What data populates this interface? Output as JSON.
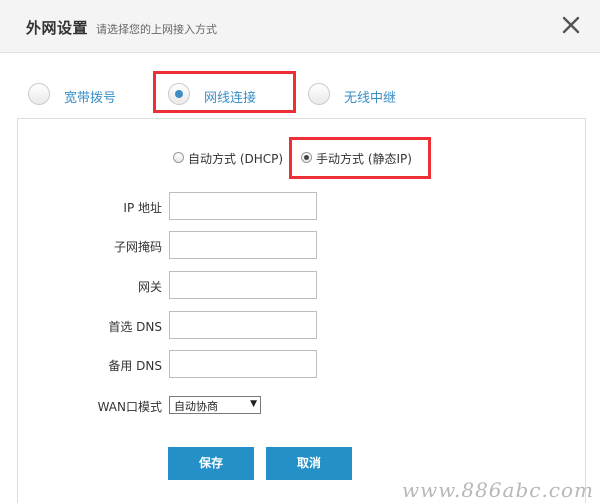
{
  "dialog": {
    "title": "外网设置",
    "subtitle": "请选择您的上网接入方式"
  },
  "tabs": [
    {
      "label": "宽带拨号",
      "selected": false
    },
    {
      "label": "网线连接",
      "selected": true
    },
    {
      "label": "无线中继",
      "selected": false
    }
  ],
  "modes": [
    {
      "label": "自动方式 (DHCP)",
      "selected": false
    },
    {
      "label": "手动方式 (静态IP)",
      "selected": true
    }
  ],
  "fields": [
    {
      "label": "IP 地址",
      "value": ""
    },
    {
      "label": "子网掩码",
      "value": ""
    },
    {
      "label": "网关",
      "value": ""
    },
    {
      "label": "首选 DNS",
      "value": ""
    },
    {
      "label": "备用 DNS",
      "value": ""
    }
  ],
  "wan_mode": {
    "label": "WAN口模式",
    "value": "自动协商"
  },
  "buttons": {
    "save": "保存",
    "cancel": "取消"
  },
  "watermark": "www.886abc.com",
  "colors": {
    "accent": "#2590c8",
    "highlight": "#ee2f36",
    "tab_text": "#3a8fc5"
  }
}
